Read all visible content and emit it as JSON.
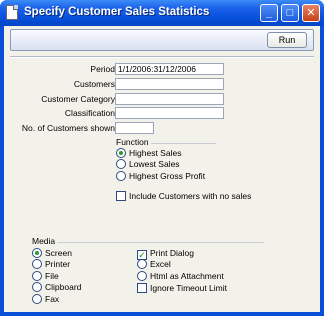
{
  "window": {
    "title": "Specify Customer Sales Statistics"
  },
  "titlebar_buttons": {
    "minimize": "_",
    "maximize": "□",
    "close": "✕"
  },
  "toolbar": {
    "run_label": "Run"
  },
  "fields": [
    {
      "label": "Period",
      "value": "1/1/2006:31/12/2006"
    },
    {
      "label": "Customers",
      "value": ""
    },
    {
      "label": "Customer Category",
      "value": ""
    },
    {
      "label": "Classification",
      "value": ""
    },
    {
      "label": "No. of Customers shown",
      "value": ""
    }
  ],
  "function_group": {
    "title": "Function",
    "options": [
      {
        "label": "Highest Sales",
        "selected": true
      },
      {
        "label": "Lowest Sales",
        "selected": false
      },
      {
        "label": "Highest Gross Profit",
        "selected": false
      }
    ]
  },
  "include_no_sales": {
    "label": "Include Customers with no sales",
    "checked": false
  },
  "media_group": {
    "title": "Media",
    "options": [
      {
        "label": "Screen",
        "selected": true
      },
      {
        "label": "Printer",
        "selected": false
      },
      {
        "label": "File",
        "selected": false
      },
      {
        "label": "Clipboard",
        "selected": false
      },
      {
        "label": "Fax",
        "selected": false
      }
    ],
    "right_options": [
      {
        "label": "Print Dialog",
        "kind": "checkbox",
        "checked": true
      },
      {
        "label": "Excel",
        "kind": "radio",
        "selected": false
      },
      {
        "label": "Html as Attachment",
        "kind": "radio",
        "selected": false
      },
      {
        "label": "Ignore Timeout Limit",
        "kind": "checkbox",
        "checked": false
      }
    ]
  },
  "colors": {
    "titlebar": "#0550dc",
    "dialog_bg": "#f3f2ea",
    "radio_dot": "#2b9a2b"
  }
}
